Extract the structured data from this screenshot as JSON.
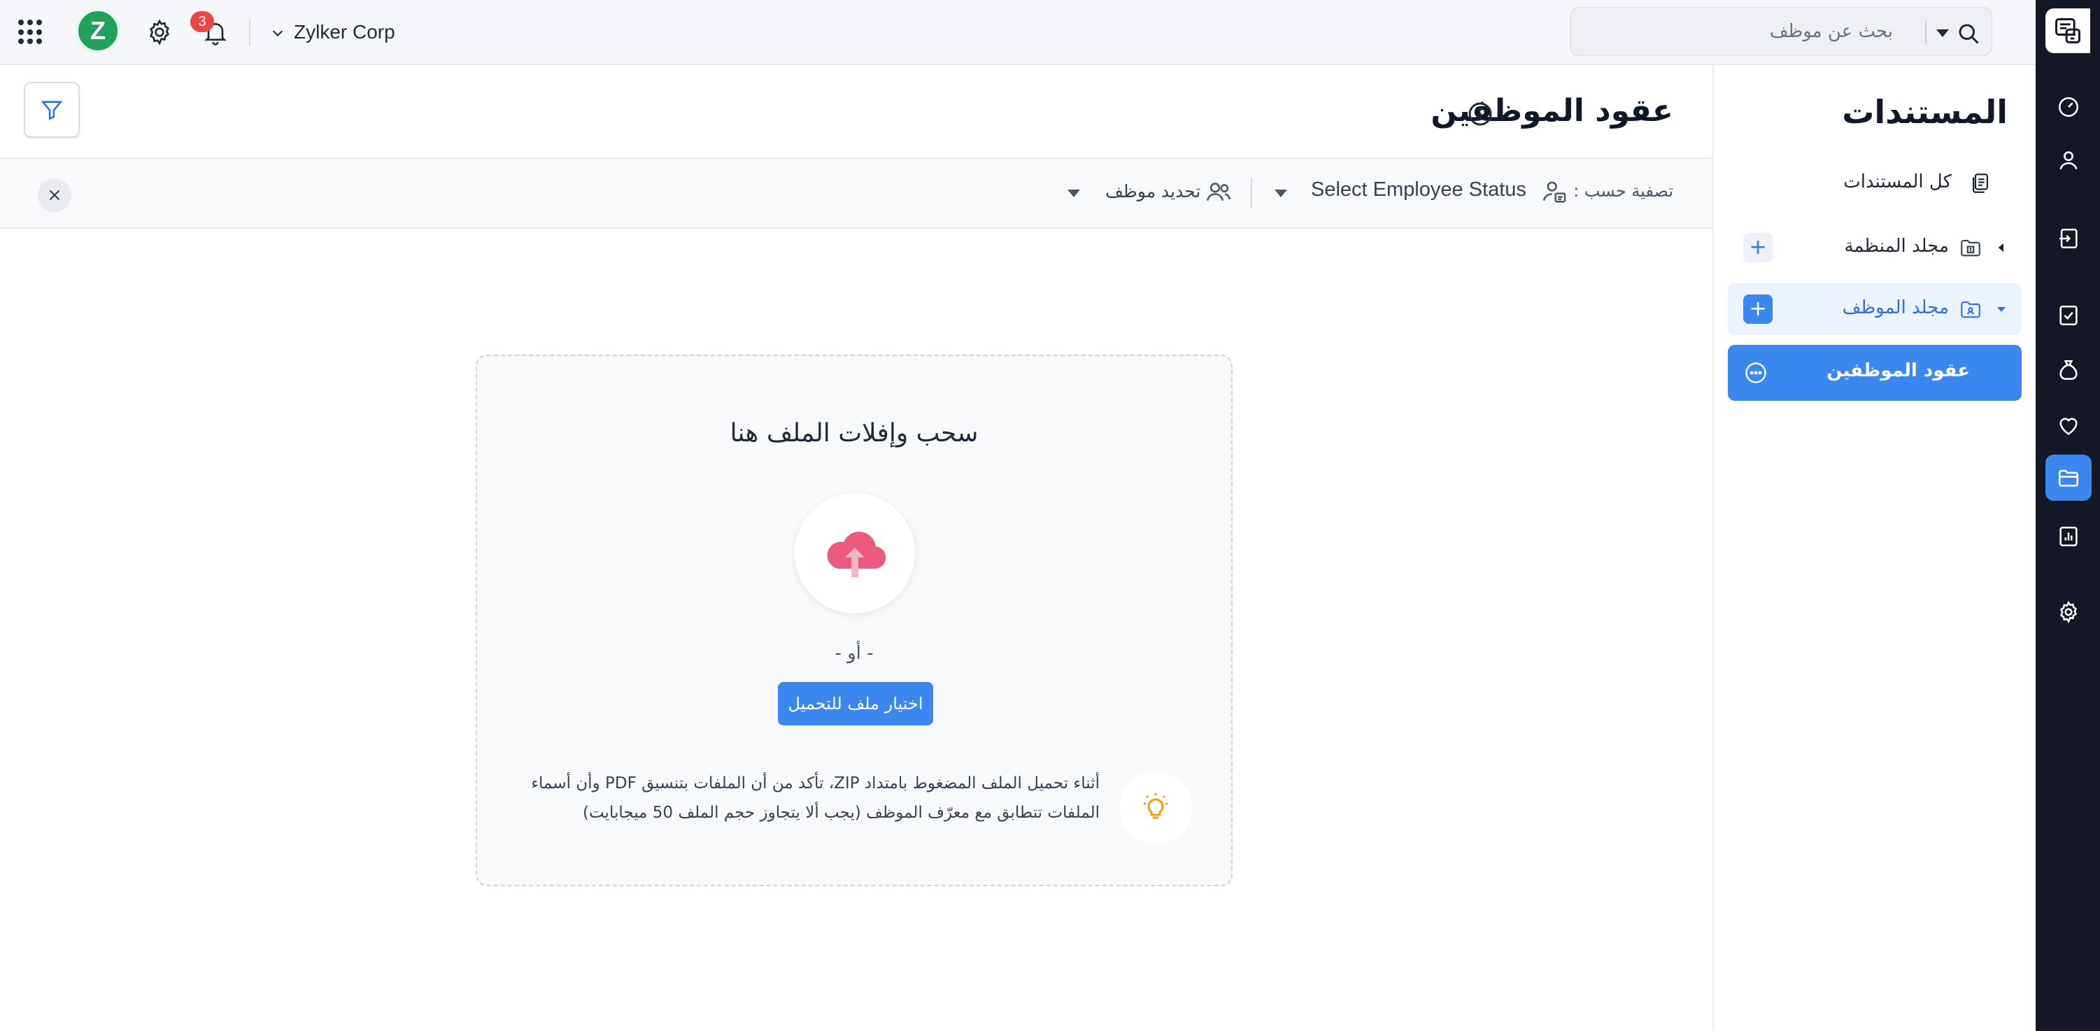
{
  "topbar": {
    "org_name": "Zylker Corp",
    "avatar_letter": "Z",
    "notification_count": "3",
    "search_placeholder": "بحث عن موظف"
  },
  "sidebar": {
    "title": "المستندات",
    "all_documents": "كل المستندات",
    "org_folder": "مجلد المنظمة",
    "employee_folder": "مجلد الموظف",
    "active_item": "عقود الموظفين"
  },
  "main": {
    "title": "عقود الموظفين",
    "filter_by": "تصفية حسب :",
    "status_select": "Select Employee Status",
    "employee_select": "تحديد موظف"
  },
  "upload": {
    "title": "سحب وإفلات الملف هنا",
    "or": "- أو -",
    "button": "اختيار ملف للتحميل",
    "hint": "أثناء تحميل الملف المضغوط بامتداد ZIP، تأكد من أن الملفات بتنسيق PDF وأن أسماء الملفات تتطابق مع معرّف الموظف (يجب ألا يتجاوز حجم الملف 50 ميجابايت)"
  },
  "colors": {
    "accent": "#3b87f0",
    "rail": "#141826",
    "avatar": "#21a15c",
    "badge": "#ef4444",
    "upload_icon": "#ec5b7d"
  },
  "icons": {
    "rail": [
      "documents-logo-icon",
      "dashboard-icon",
      "person-icon",
      "login-icon",
      "tasks-icon",
      "money-bag-icon",
      "heart-icon",
      "folder-icon",
      "reports-icon",
      "settings-icon"
    ]
  }
}
